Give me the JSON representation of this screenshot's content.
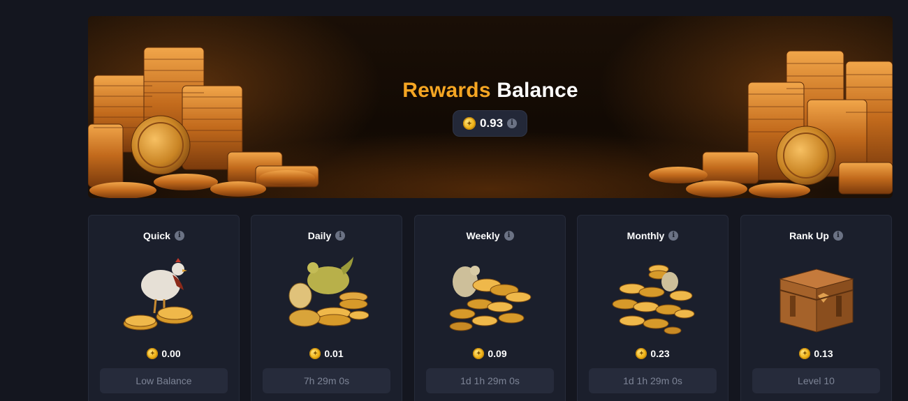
{
  "banner": {
    "title_accent": "Rewards",
    "title_rest": "Balance",
    "balance": "0.93",
    "coin_icon": "chicken-coin-icon",
    "info_icon": "info-icon"
  },
  "cards": [
    {
      "title": "Quick",
      "value": "0.00",
      "action": "Low Balance",
      "art": "chicken-with-coins"
    },
    {
      "title": "Daily",
      "value": "0.01",
      "action": "7h 29m 0s",
      "art": "chicken-on-coins"
    },
    {
      "title": "Weekly",
      "value": "0.09",
      "action": "1d 1h 29m 0s",
      "art": "chicken-coin-pile"
    },
    {
      "title": "Monthly",
      "value": "0.23",
      "action": "1d 1h 29m 0s",
      "art": "large-coin-pile"
    },
    {
      "title": "Rank Up",
      "value": "0.13",
      "action": "Level 10",
      "art": "treasure-crate"
    }
  ],
  "colors": {
    "accent": "#f5a623",
    "background": "#14161f",
    "card": "#1b1f2c",
    "button": "#262b3b",
    "muted_text": "#7d8496"
  }
}
